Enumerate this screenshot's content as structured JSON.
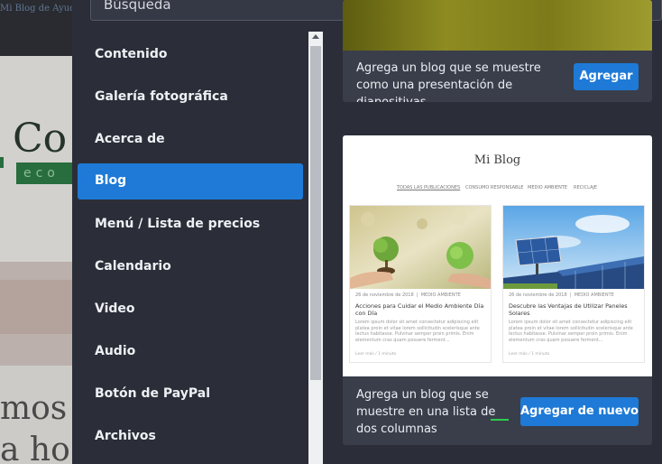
{
  "background_site": {
    "topbar_text": "Mi Blog de Ayuda",
    "logo_text": "Co",
    "tagline": "eco",
    "line1": "mos",
    "line2": "a ho"
  },
  "search": {
    "placeholder": "Búsqueda"
  },
  "nav": {
    "items": [
      {
        "label": "Contenido",
        "active": false
      },
      {
        "label": "Galería fotográfica",
        "active": false
      },
      {
        "label": "Acerca de",
        "active": false
      },
      {
        "label": "Blog",
        "active": true
      },
      {
        "label": "Menú / Lista de precios",
        "active": false
      },
      {
        "label": "Calendario",
        "active": false
      },
      {
        "label": "Video",
        "active": false
      },
      {
        "label": "Audio",
        "active": false
      },
      {
        "label": "Botón de PayPal",
        "active": false
      },
      {
        "label": "Archivos",
        "active": false
      }
    ]
  },
  "cards": [
    {
      "description": "Agrega un blog que se muestre como una presentación de diapositivas",
      "button_label": "Agregar"
    },
    {
      "description": "Agrega un blog que se muestre en una lista de dos columnas",
      "button_label": "Agregar de nuevo",
      "preview": {
        "blog_title": "Mi Blog",
        "menu": [
          "TODAS LAS PUBLICACIONES",
          "CONSUMO RESPONSABLE",
          "MEDIO AMBIENTE",
          "RECICLAJE"
        ],
        "posts": [
          {
            "date": "26 de noviembre de 2018",
            "category": "MEDIO AMBIENTE",
            "title": "Acciones para Cuidar el Medio Ambiente Día con Día",
            "excerpt": "Lorem ipsum dolor sit amet consectetur adipiscing elit platea proin et vitae lorem sollicitudin scelerisque ante lectus habitasse. Pulvinar semper proin primis. Enim elementum cras quam posuere ferment...",
            "read_more": "Leer más / 1 minuto"
          },
          {
            "date": "26 de noviembre de 2018",
            "category": "MEDIO AMBIENTE",
            "title": "Descubre las Ventajas de Utilizar Paneles Solares",
            "excerpt": "Lorem ipsum dolor sit amet consectetur adipiscing elit platea proin et vitae lorem sollicitudin scelerisque ante lectus habitasse. Pulvinar semper proin primis. Enim elementum cras quam posuere ferment...",
            "read_more": "Leer más / 1 minuto"
          }
        ]
      }
    }
  ],
  "colors": {
    "panel_bg": "#2b2e38",
    "card_bg": "#3a3e4a",
    "accent_blue": "#1e7ad6",
    "highlight_green": "#2ecc4f"
  }
}
